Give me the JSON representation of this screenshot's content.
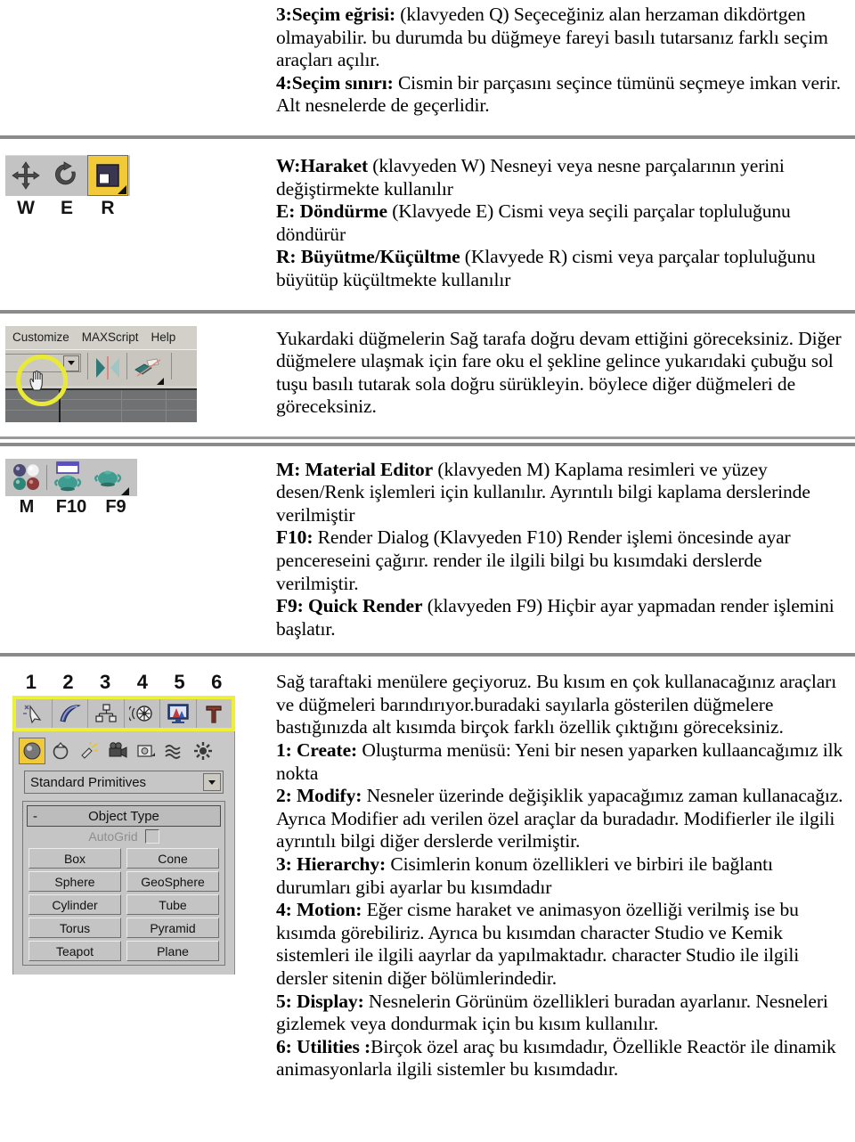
{
  "sections": {
    "selection": {
      "paragraphs": [
        {
          "bold": "3:Seçim eğrisi:",
          "rest": " (klavyeden Q) Seçeceğiniz alan herzaman dikdörtgen olmayabilir. bu durumda bu düğmeye fareyi basılı tutarsanız farklı seçim araçları açılır."
        },
        {
          "bold": "4:Seçim sınırı:",
          "rest": " Cismin bir parçasını seçince tümünü seçmeye imkan verir. Alt nesnelerde de geçerlidir."
        }
      ]
    },
    "transform": {
      "figure": {
        "name": "transform-toolbar",
        "buttons": [
          {
            "label": "W",
            "icon": "move-icon",
            "active": false
          },
          {
            "label": "E",
            "icon": "rotate-icon",
            "active": false
          },
          {
            "label": "R",
            "icon": "scale-icon",
            "active": true
          }
        ]
      },
      "paragraphs": [
        {
          "bold": "W:Haraket",
          "rest": " (klavyeden W) Nesneyi veya nesne parçalarının yerini değiştirmekte kullanılır"
        },
        {
          "bold": "E: Döndürme",
          "rest": " (Klavyede E) Cismi veya seçili parçalar topluluğunu döndürür"
        },
        {
          "bold": "R: Büyütme/Küçültme",
          "rest": " (Klavyede R) cismi veya parçalar topluluğunu büyütüp küçültmekte kullanılır"
        }
      ]
    },
    "toolbar_scroll": {
      "figure": {
        "name": "menu-bar-screenshot",
        "menu_items": [
          "Customize",
          "MAXScript",
          "Help"
        ],
        "toolbar_icons": [
          "mirror-icon",
          "align-icon"
        ],
        "cursor": "hand-cursor",
        "highlight_color": "#e9e93a"
      },
      "paragraphs": [
        {
          "bold": "",
          "rest": "Yukardaki düğmelerin Sağ tarafa doğru devam ettiğini göreceksiniz. Diğer düğmelere ulaşmak için fare oku el şekline gelince yukarıdaki çubuğu sol tuşu basılı tutarak sola doğru sürükleyin. böylece diğer düğmeleri de göreceksiniz."
        }
      ]
    },
    "render": {
      "figure": {
        "name": "render-toolbar",
        "buttons": [
          {
            "label": "M",
            "icon": "material-editor-icon"
          },
          {
            "label": "F10",
            "icon": "render-setup-icon"
          },
          {
            "label": "F9",
            "icon": "quick-render-icon"
          }
        ]
      },
      "paragraphs": [
        {
          "bold": "M: Material Editor",
          "rest": " (klavyeden M) Kaplama resimleri ve yüzey desen/Renk işlemleri için kullanılır. Ayrıntılı bilgi kaplama derslerinde verilmiştir"
        },
        {
          "bold": "F10:",
          "rest": " Render Dialog (Klavyeden F10) Render işlemi öncesinde ayar pencereseini çağırır. render ile ilgili bilgi bu kısımdaki derslerde verilmiştir."
        },
        {
          "bold": "F9: Quick Render",
          "rest": " (klavyeden F9) Hiçbir ayar yapmadan render işlemini başlatır."
        }
      ]
    },
    "command_panel": {
      "figure": {
        "name": "command-panel-screenshot",
        "numbers": [
          "1",
          "2",
          "3",
          "4",
          "5",
          "6"
        ],
        "tabs": [
          {
            "number": "1",
            "icon": "create-icon"
          },
          {
            "number": "2",
            "icon": "modify-icon"
          },
          {
            "number": "3",
            "icon": "hierarchy-icon"
          },
          {
            "number": "4",
            "icon": "motion-icon"
          },
          {
            "number": "5",
            "icon": "display-icon"
          },
          {
            "number": "6",
            "icon": "utilities-icon"
          }
        ],
        "categories": [
          {
            "icon": "geometry-icon",
            "active": true
          },
          {
            "icon": "shapes-icon",
            "active": false
          },
          {
            "icon": "lights-icon",
            "active": false
          },
          {
            "icon": "cameras-icon",
            "active": false
          },
          {
            "icon": "helpers-icon",
            "active": false
          },
          {
            "icon": "space-warps-icon",
            "active": false
          },
          {
            "icon": "systems-icon",
            "active": false
          }
        ],
        "dropdown_value": "Standard Primitives",
        "rollout_title": "Object Type",
        "rollout_collapse": "-",
        "autogrid_label": "AutoGrid",
        "object_buttons": [
          "Box",
          "Cone",
          "Sphere",
          "GeoSphere",
          "Cylinder",
          "Tube",
          "Torus",
          "Pyramid",
          "Teapot",
          "Plane"
        ]
      },
      "paragraphs": [
        {
          "bold": "",
          "rest": "Sağ taraftaki menülere geçiyoruz. Bu kısım en çok kullanacağınız araçları ve düğmeleri barındırıyor.buradaki sayılarla gösterilen düğmelere bastığınızda alt kısımda birçok farklı özellik çıktığını göreceksiniz."
        },
        {
          "bold": "1: Create:",
          "rest": " Oluşturma menüsü: Yeni bir nesen yaparken kullaancağımız ilk nokta"
        },
        {
          "bold": "2: Modify:",
          "rest": " Nesneler üzerinde değişiklik yapacağımız zaman kullanacağız. Ayrıca Modifier adı verilen özel araçlar da buradadır. Modifierler ile ilgili ayrıntılı bilgi diğer derslerde verilmiştir."
        },
        {
          "bold": "3: Hierarchy:",
          "rest": " Cisimlerin konum özellikleri ve birbiri ile bağlantı durumları gibi ayarlar bu kısımdadır"
        },
        {
          "bold": "4: Motion:",
          "rest": " Eğer cisme haraket ve animasyon özelliği verilmiş ise bu kısımda görebiliriz. Ayrıca bu kısımdan character Studio ve Kemik sistemleri ile ilgili aayrlar da yapılmaktadır. character Studio ile ilgili dersler sitenin diğer bölümlerindedir."
        },
        {
          "bold": "5: Display:",
          "rest": " Nesnelerin Görünüm özellikleri buradan ayarlanır. Nesneleri gizlemek veya dondurmak için bu kısım kullanılır."
        },
        {
          "bold": "6: Utilities :",
          "rest": "Birçok özel araç bu kısımdadır, Özellikle Reactör ile dinamik animasyonlarla ilgili sistemler bu kısımdadır."
        }
      ]
    }
  },
  "colors": {
    "rule": "#8a8a8a",
    "highlight_yellow": "#efef3a",
    "active_button": "#f2c938",
    "toolbar_gray": "#c3c3c3"
  }
}
